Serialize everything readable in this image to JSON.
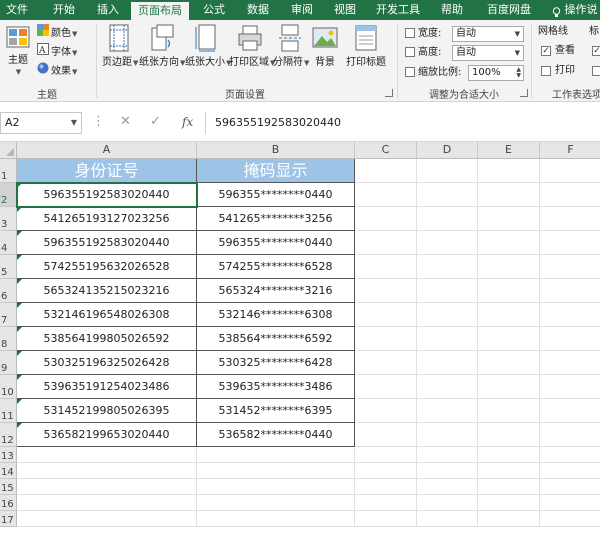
{
  "ribbon_tabs": [
    "文件",
    "开始",
    "插入",
    "页面布局",
    "公式",
    "数据",
    "审阅",
    "视图",
    "开发工具",
    "帮助",
    "百度网盘"
  ],
  "search_label": "操作说",
  "themes": {
    "theme_label": "主题",
    "colors_label": "颜色",
    "fonts_label": "字体",
    "effects_label": "效果",
    "group_label": "主题"
  },
  "page_setup": {
    "margins": "页边距",
    "orientation": "纸张方向",
    "size": "纸张大小",
    "print_area": "打印区域",
    "breaks": "分隔符",
    "background": "背景",
    "print_titles": "打印标题",
    "group_label": "页面设置"
  },
  "scale_to_fit": {
    "width_label": "宽度:",
    "width_value": "自动",
    "height_label": "高度:",
    "height_value": "自动",
    "scale_label": "缩放比例:",
    "scale_value": "100%",
    "group_label": "调整为合适大小"
  },
  "sheet_options": {
    "gridlines_label": "网格线",
    "view_label": "查看",
    "print_label": "打印",
    "headings_label": "标",
    "group_label": "工作表选项"
  },
  "formula_bar": {
    "name_box": "A2",
    "formula": "596355192583020440"
  },
  "columns": [
    "A",
    "B",
    "C",
    "D",
    "E",
    "F"
  ],
  "rows": [
    "1",
    "2",
    "3",
    "4",
    "5",
    "6",
    "7",
    "8",
    "9",
    "10",
    "11",
    "12",
    "13",
    "14",
    "15",
    "16",
    "17"
  ],
  "table": {
    "headers": [
      "身份证号",
      "掩码显示"
    ],
    "rows": [
      [
        "596355192583020440",
        "596355********0440"
      ],
      [
        "541265193127023256",
        "541265********3256"
      ],
      [
        "596355192583020440",
        "596355********0440"
      ],
      [
        "574255195632026528",
        "574255********6528"
      ],
      [
        "565324135215023216",
        "565324********3216"
      ],
      [
        "532146196548026308",
        "532146********6308"
      ],
      [
        "538564199805026592",
        "538564********6592"
      ],
      [
        "530325196325026428",
        "530325********6428"
      ],
      [
        "539635191254023486",
        "539635********3486"
      ],
      [
        "531452199805026395",
        "531452********6395"
      ],
      [
        "536582199653020440",
        "536582********0440"
      ]
    ]
  },
  "colors": {
    "excel_green": "#217346",
    "header_fill": "#9dc3e6",
    "header_text": "#ffffff"
  }
}
